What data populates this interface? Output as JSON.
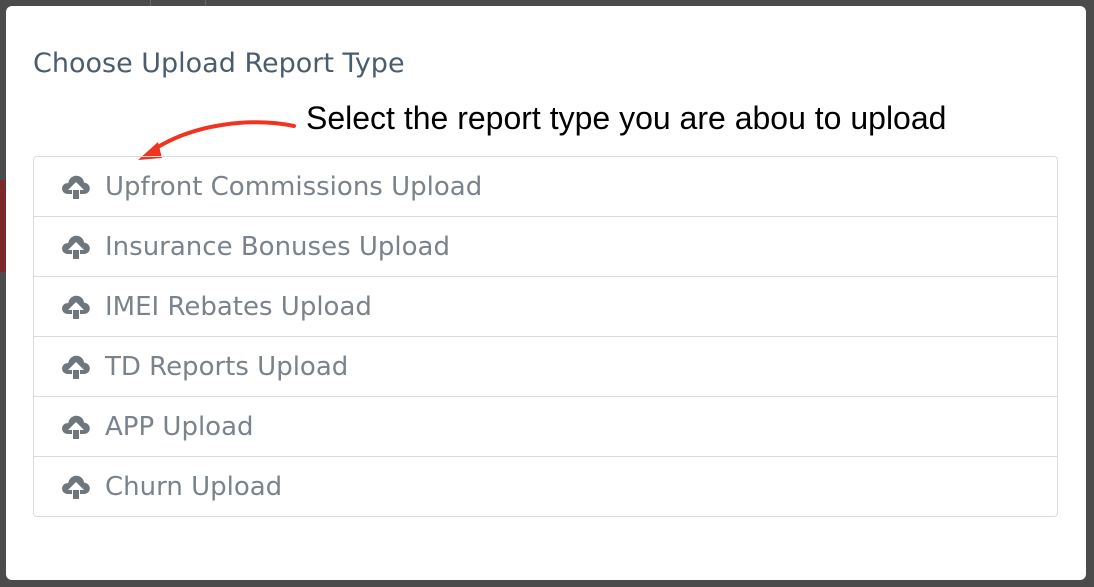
{
  "modal": {
    "title": "Choose Upload Report Type"
  },
  "annotation": {
    "text": "Select the report type you are abou to upload",
    "arrow_color": "#f0341f"
  },
  "upload_list": {
    "items": [
      {
        "label": "Upfront Commissions Upload",
        "icon": "cloud-upload-icon"
      },
      {
        "label": "Insurance Bonuses Upload",
        "icon": "cloud-upload-icon"
      },
      {
        "label": "IMEI Rebates Upload",
        "icon": "cloud-upload-icon"
      },
      {
        "label": "TD Reports Upload",
        "icon": "cloud-upload-icon"
      },
      {
        "label": "APP Upload",
        "icon": "cloud-upload-icon"
      },
      {
        "label": "Churn Upload",
        "icon": "cloud-upload-icon"
      }
    ]
  },
  "colors": {
    "title": "#4a5c6e",
    "item_text": "#7a838c",
    "icon": "#6e767e",
    "border": "#dcdcdc",
    "backdrop": "#4b4b4b"
  }
}
